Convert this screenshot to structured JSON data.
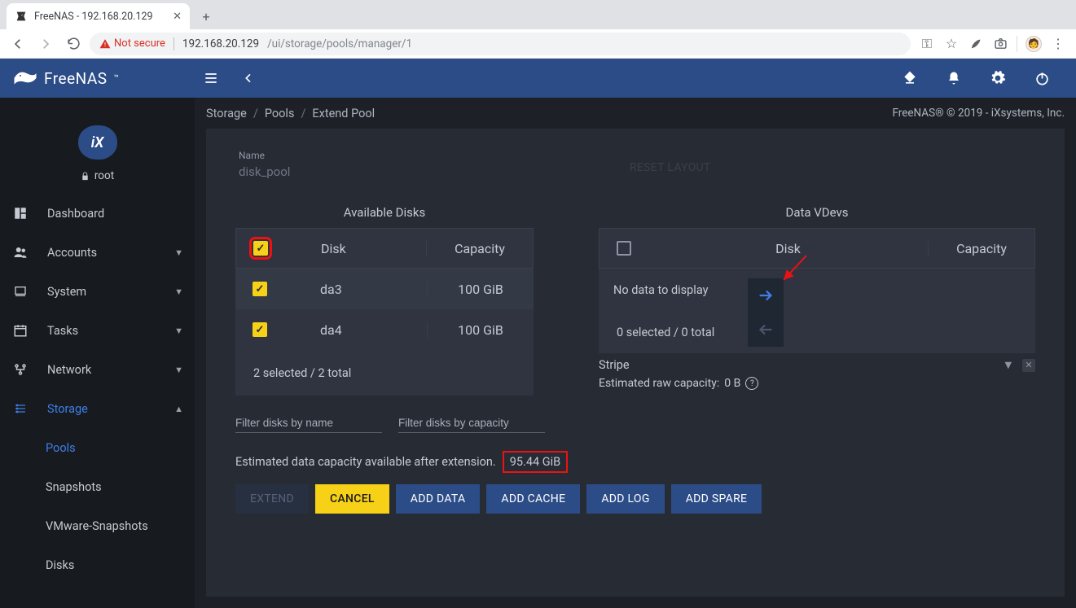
{
  "browser": {
    "tab_title": "FreeNAS - 192.168.20.129",
    "not_secure": "Not secure",
    "url_host": "192.168.20.129",
    "url_path": "/ui/storage/pools/manager/1"
  },
  "topbar": {
    "brand": "FreeNAS"
  },
  "sidebar": {
    "user": "root",
    "items": [
      {
        "label": "Dashboard"
      },
      {
        "label": "Accounts"
      },
      {
        "label": "System"
      },
      {
        "label": "Tasks"
      },
      {
        "label": "Network"
      },
      {
        "label": "Storage"
      }
    ],
    "storage_children": [
      {
        "label": "Pools"
      },
      {
        "label": "Snapshots"
      },
      {
        "label": "VMware-Snapshots"
      },
      {
        "label": "Disks"
      }
    ]
  },
  "breadcrumb": {
    "a": "Storage",
    "b": "Pools",
    "c": "Extend Pool",
    "copyright": "FreeNAS® © 2019 - iXsystems, Inc."
  },
  "form": {
    "name_label": "Name",
    "name_value": "disk_pool",
    "reset": "RESET LAYOUT",
    "available_title": "Available Disks",
    "vdevs_title": "Data VDevs",
    "headers": {
      "disk": "Disk",
      "capacity": "Capacity"
    },
    "available_rows": [
      {
        "disk": "da3",
        "capacity": "100 GiB"
      },
      {
        "disk": "da4",
        "capacity": "100 GiB"
      }
    ],
    "available_footer": "2 selected / 2 total",
    "nodata": "No data to display",
    "vdev_footer": "0 selected / 0 total",
    "layout": "Stripe",
    "est_raw_label": "Estimated raw capacity: ",
    "est_raw_value": "0 B",
    "filter_name_ph": "Filter disks by name",
    "filter_cap_ph": "Filter disks by capacity",
    "est_line": "Estimated data capacity available after extension.",
    "est_value": "95.44 GiB",
    "buttons": {
      "extend": "EXTEND",
      "cancel": "CANCEL",
      "add_data": "ADD DATA",
      "add_cache": "ADD CACHE",
      "add_log": "ADD LOG",
      "add_spare": "ADD SPARE"
    }
  }
}
